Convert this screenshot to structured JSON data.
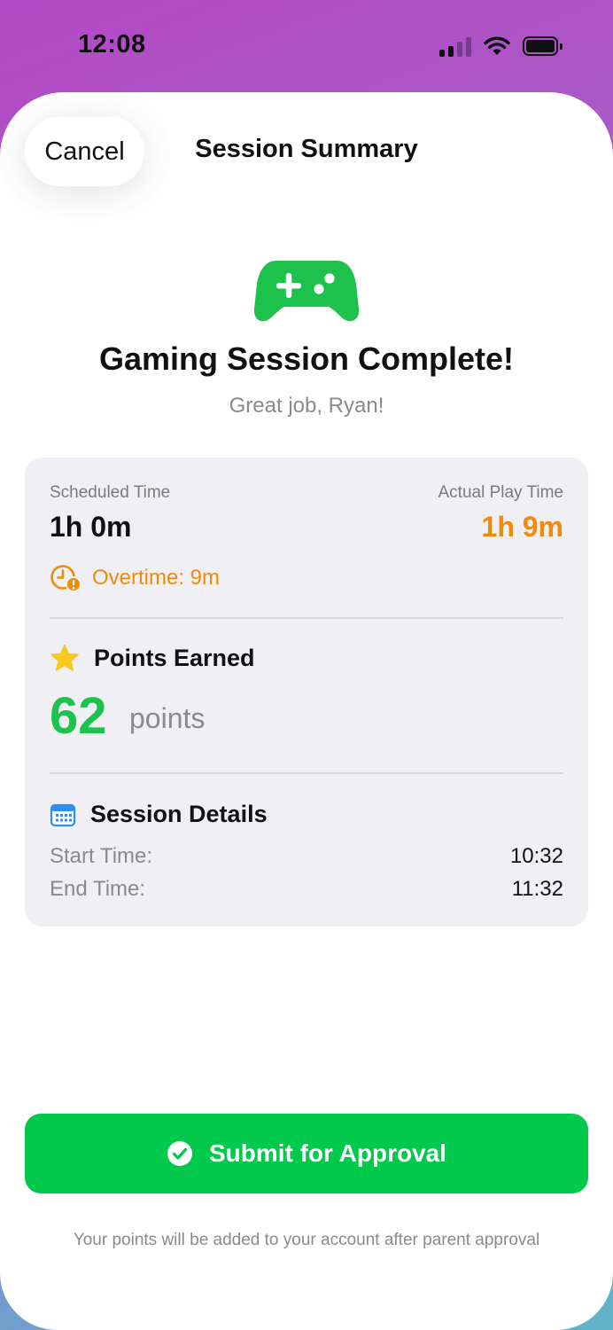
{
  "status_bar": {
    "time": "12:08"
  },
  "header": {
    "cancel_label": "Cancel",
    "title": "Session Summary"
  },
  "hero": {
    "icon": "game-controller-icon",
    "title": "Gaming Session Complete!",
    "subtitle": "Great job, Ryan!"
  },
  "time_summary": {
    "scheduled_label": "Scheduled Time",
    "scheduled_value": "1h 0m",
    "actual_label": "Actual Play Time",
    "actual_value": "1h 9m",
    "overtime_text": "Overtime: 9m"
  },
  "points": {
    "heading": "Points Earned",
    "value": "62",
    "unit": "points"
  },
  "details": {
    "heading": "Session Details",
    "rows": [
      {
        "label": "Start Time:",
        "value": "10:32"
      },
      {
        "label": "End Time:",
        "value": "11:32"
      }
    ]
  },
  "submit": {
    "label": "Submit for Approval"
  },
  "footnote": "Your points will be added to your account after parent approval",
  "colors": {
    "accent_green": "#00c94b",
    "points_green": "#1dc24c",
    "overtime_orange": "#f08a0a"
  }
}
